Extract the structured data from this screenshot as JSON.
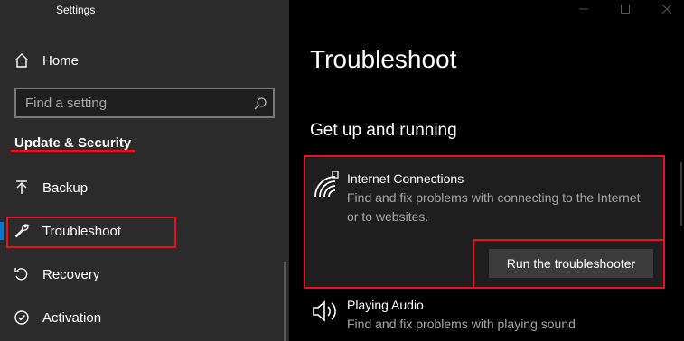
{
  "window": {
    "title": "Settings",
    "controls": [
      "minimize",
      "maximize",
      "close"
    ]
  },
  "sidebar": {
    "home_label": "Home",
    "search_placeholder": "Find a setting",
    "section_title": "Update & Security",
    "items": [
      {
        "label": "Backup",
        "icon": "backup-arrow-icon"
      },
      {
        "label": "Troubleshoot",
        "icon": "wrench-icon",
        "active": true
      },
      {
        "label": "Recovery",
        "icon": "recovery-icon"
      },
      {
        "label": "Activation",
        "icon": "activation-check-icon"
      }
    ]
  },
  "main": {
    "title": "Troubleshoot",
    "section": "Get up and running",
    "troubleshooters": [
      {
        "title": "Internet Connections",
        "description": "Find and fix problems with connecting to the Internet or to websites.",
        "icon": "wifi-signal-icon",
        "button": "Run the troubleshooter"
      },
      {
        "title": "Playing Audio",
        "description": "Find and fix problems with playing sound",
        "icon": "speaker-icon"
      }
    ]
  },
  "colors": {
    "sidebar_bg": "#2b2b2b",
    "main_bg": "#000000",
    "accent": "#0078d7",
    "annotation_red": "#e81123",
    "card_bg": "#1e1e1e",
    "button_bg": "#3b3b3b"
  }
}
